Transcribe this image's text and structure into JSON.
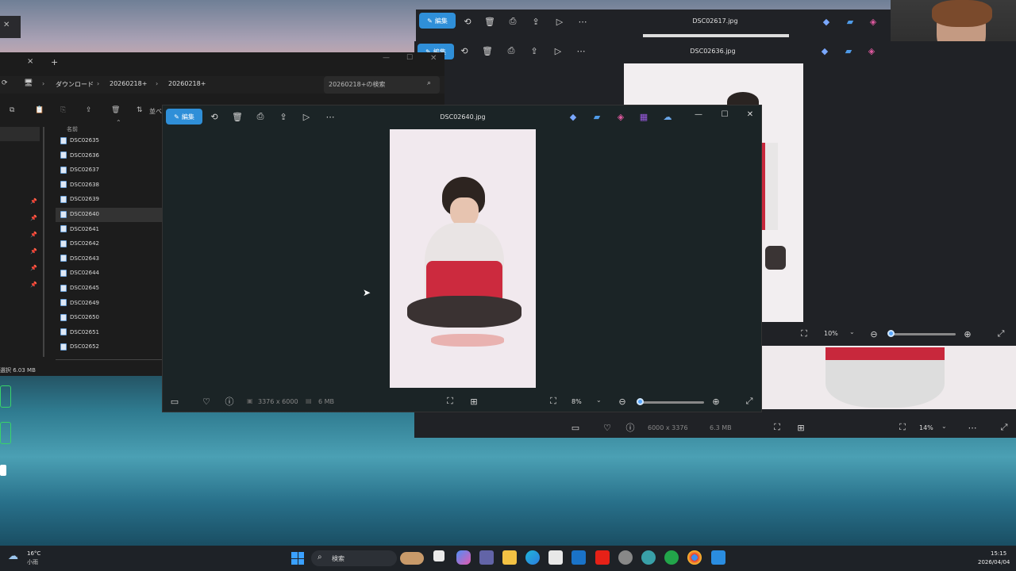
{
  "explorer": {
    "path": [
      "ダウンロード",
      "20260218+",
      "20260218+"
    ],
    "search_placeholder": "20260218+の検索",
    "column_name": "名前",
    "files": [
      "DSC02635",
      "DSC02636",
      "DSC02637",
      "DSC02638",
      "DSC02639",
      "DSC02640",
      "DSC02641",
      "DSC02642",
      "DSC02643",
      "DSC02644",
      "DSC02645",
      "DSC02649",
      "DSC02650",
      "DSC02651",
      "DSC02652"
    ],
    "selected_file": "DSC02640",
    "status": "選択 6.03 MB",
    "sort_label": "並べ"
  },
  "viewer_back1": {
    "title": "DSC02617.jpg",
    "edit_label": "編集"
  },
  "viewer_back2": {
    "title": "DSC02636.jpg",
    "edit_label": "編集",
    "zoom": "10%",
    "zoom_b": "14%",
    "dimensions": "6000 x 3376",
    "size": "6.3 MB"
  },
  "viewer_main": {
    "title": "DSC02640.jpg",
    "edit_label": "編集",
    "dimensions": "3376 x 6000",
    "size": "6 MB",
    "zoom": "8%"
  },
  "taskbar": {
    "weather_temp": "16°C",
    "weather_desc": "小雨",
    "search_label": "検索",
    "time": "15:15",
    "date": "2026/04/04"
  },
  "colors": {
    "accent": "#2f8fd8",
    "window_bg": "#1f2024",
    "viewer_bg": "#192224",
    "photo_bg": "#f1e9ee"
  }
}
